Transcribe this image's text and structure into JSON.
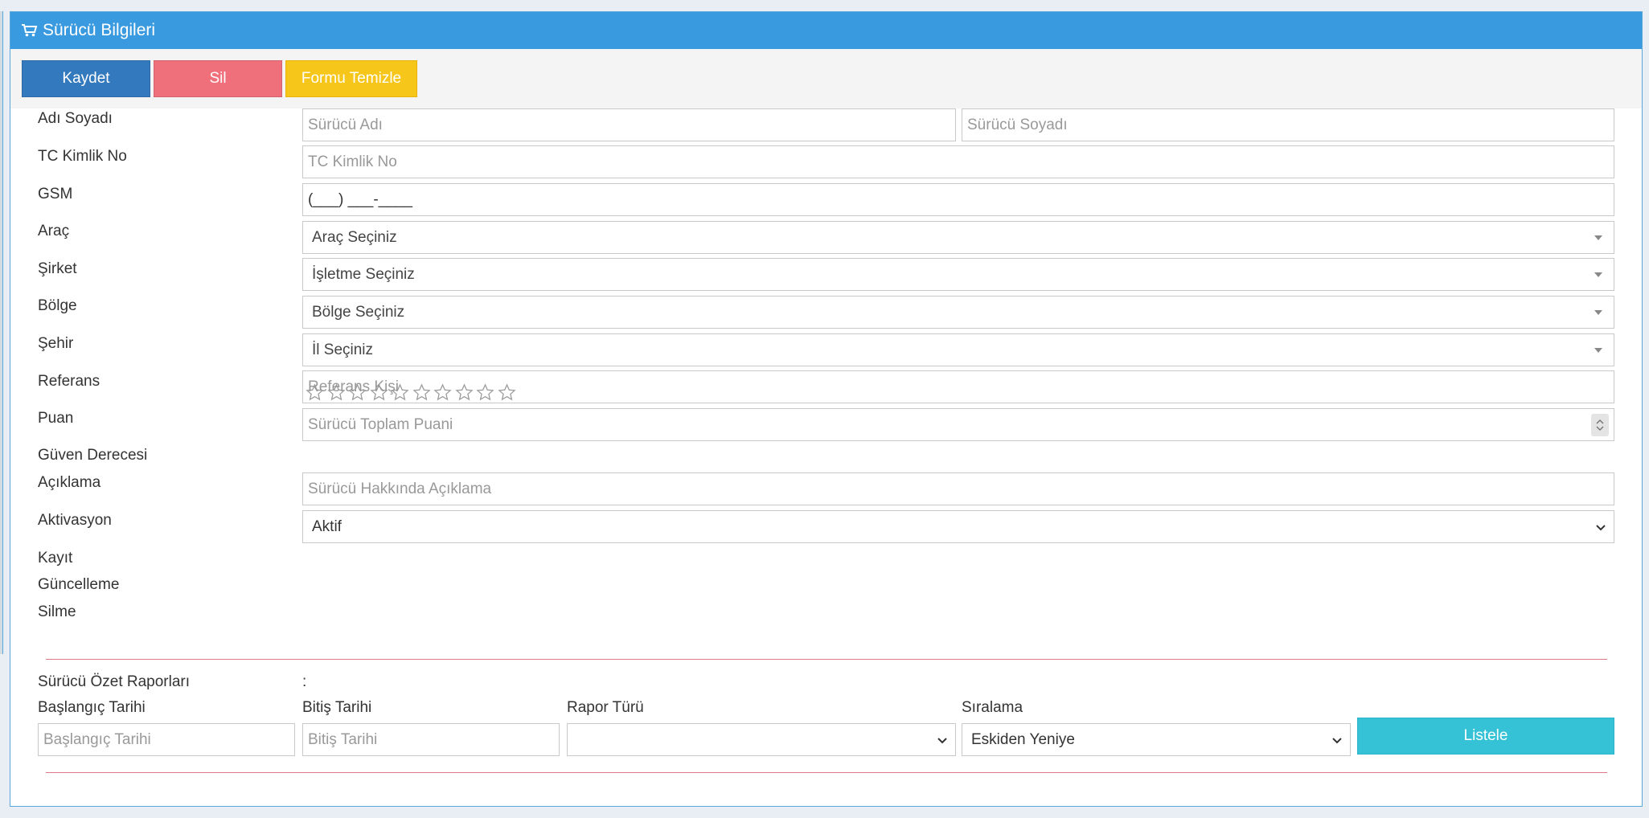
{
  "panel": {
    "title": "Sürücü Bilgileri"
  },
  "toolbar": {
    "save_label": "Kaydet",
    "delete_label": "Sil",
    "clear_label": "Formu Temizle"
  },
  "form": {
    "name_label": "Adı Soyadı",
    "first_name_placeholder": "Sürücü Adı",
    "last_name_placeholder": "Sürücü Soyadı",
    "tc_label": "TC Kimlik No",
    "tc_placeholder": "TC Kimlik No",
    "gsm_label": "GSM",
    "gsm_value": "(___) ___-____",
    "vehicle_label": "Araç",
    "vehicle_value": "Araç Seçiniz",
    "company_label": "Şirket",
    "company_value": "İşletme Seçiniz",
    "region_label": "Bölge",
    "region_value": "Bölge Seçiniz",
    "city_label": "Şehir",
    "city_value": "İl Seçiniz",
    "reference_label": "Referans",
    "reference_placeholder": "Referans Kişi",
    "score_label": "Puan",
    "score_placeholder": "Sürücü Toplam Puani",
    "trust_label": "Güven Derecesi",
    "trust_rating": 0,
    "trust_max": 10,
    "description_label": "Açıklama",
    "description_placeholder": "Sürücü Hakkında Açıklama",
    "activation_label": "Aktivasyon",
    "activation_value": "Aktif",
    "record_label": "Kayıt",
    "update_label": "Güncelleme",
    "delete_label": "Silme"
  },
  "report": {
    "title": "Sürücü Özet Raporları",
    "title_value": ":",
    "start_label": "Başlangıç Tarihi",
    "start_placeholder": "Başlangıç Tarihi",
    "end_label": "Bitiş Tarihi",
    "end_placeholder": "Bitiş Tarihi",
    "type_label": "Rapor Türü",
    "type_value": "",
    "sort_label": "Sıralama",
    "sort_value": "Eskiden Yeniye",
    "list_button": "Listele"
  },
  "colors": {
    "header": "#3a9ae0",
    "save": "#3379bd",
    "delete": "#ef6f7b",
    "clear": "#f6c61a",
    "list": "#35c2d6",
    "divider": "#e07a85"
  }
}
